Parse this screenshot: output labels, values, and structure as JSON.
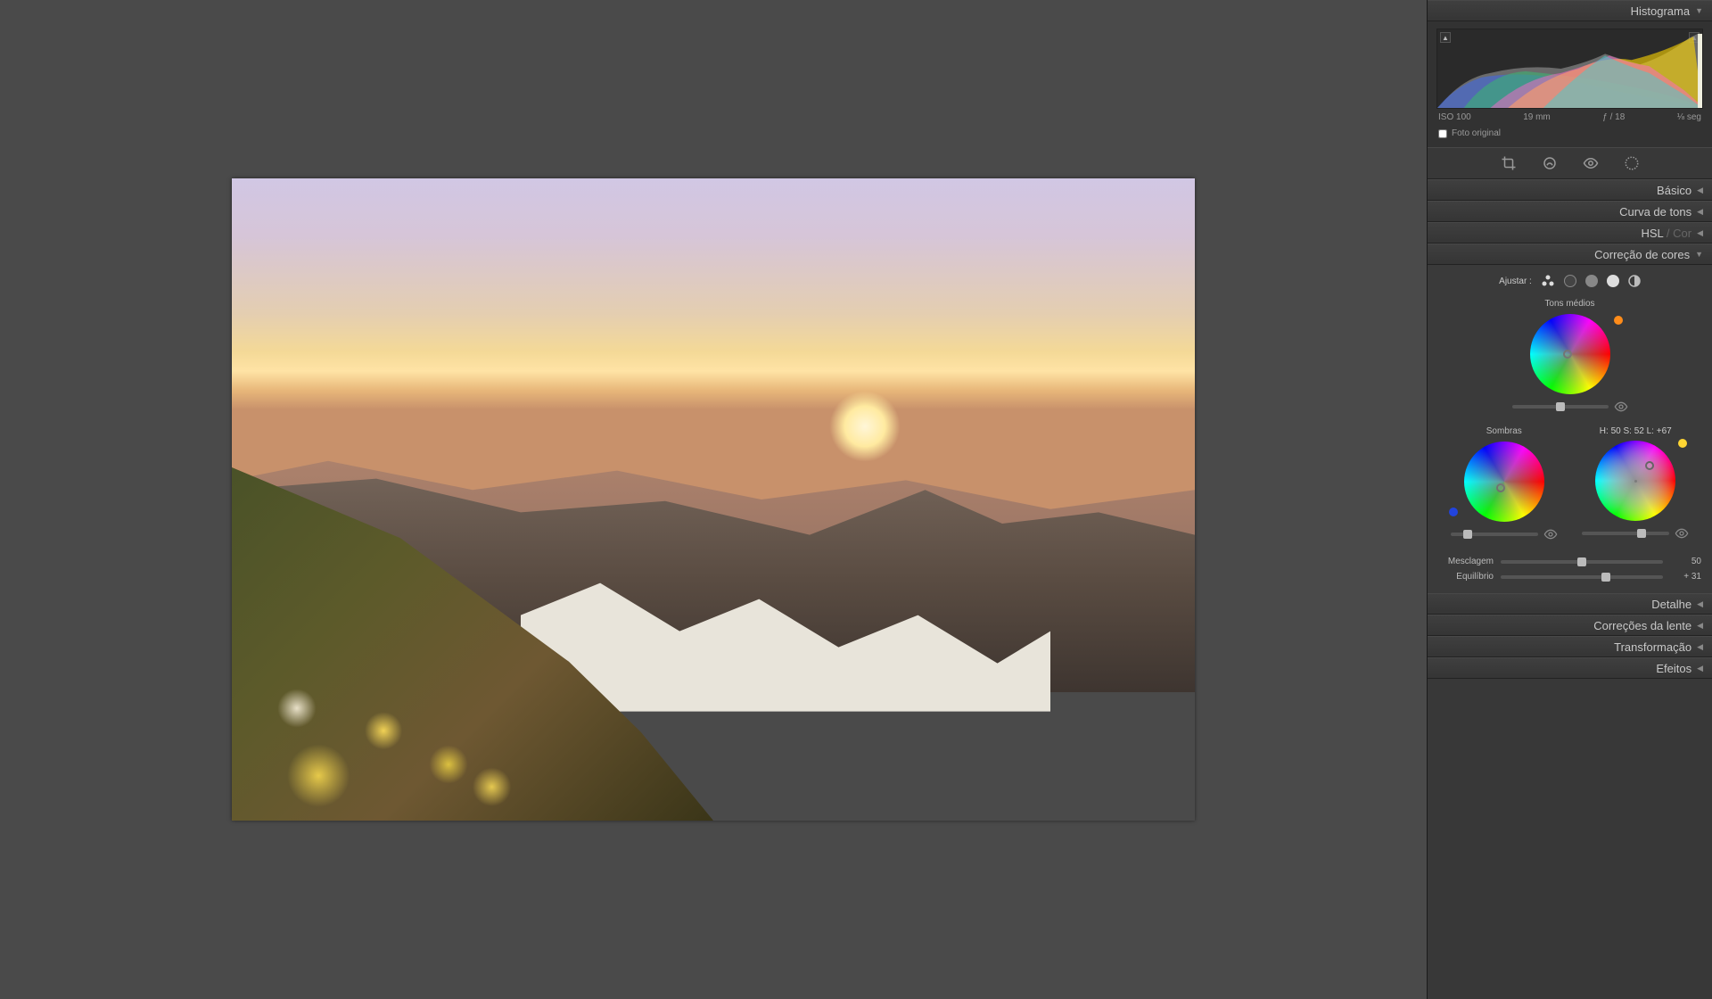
{
  "panels": {
    "histogram": "Histograma",
    "basic": "Básico",
    "toneCurve": "Curva de tons",
    "hslLabel": "HSL",
    "hslSep": " / ",
    "hslColor": "Cor",
    "colorGrading": "Correção de cores",
    "detail": "Detalhe",
    "lensCorr": "Correções da lente",
    "transform": "Transformação",
    "effects": "Efeitos"
  },
  "histogram": {
    "iso": "ISO 100",
    "focal": "19 mm",
    "aperture": "ƒ / 18",
    "shutter": "⅛ seg",
    "originalPhoto": "Foto original"
  },
  "colorGrading": {
    "adjustLabel": "Ajustar :",
    "midtones": {
      "label": "Tons médios",
      "lumPos": 50
    },
    "shadows": {
      "label": "Sombras",
      "lumPos": 20
    },
    "highlights": {
      "hsl": "H: 50 S: 52 L: +67",
      "lumPos": 68
    },
    "blending": {
      "label": "Mesclagem",
      "value": "50",
      "pos": 50
    },
    "balance": {
      "label": "Equilíbrio",
      "value": "+ 31",
      "pos": 65
    }
  }
}
